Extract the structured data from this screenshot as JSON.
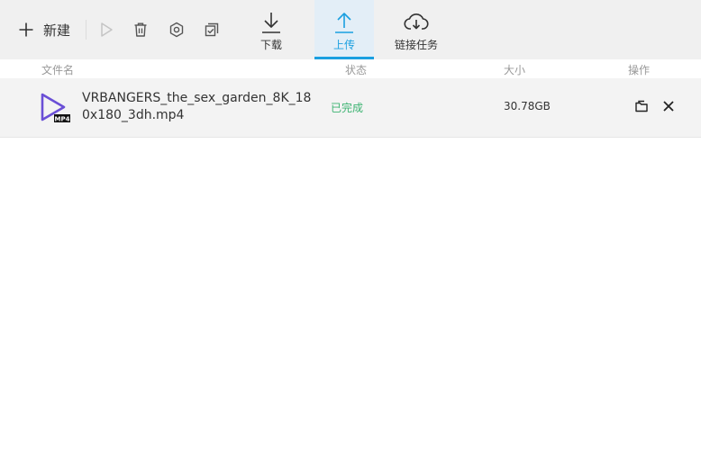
{
  "toolbar": {
    "new_label": "新建",
    "icons": [
      "plus-icon",
      "play-icon",
      "trash-icon",
      "gear-icon",
      "multi-select-icon"
    ],
    "tabs": [
      {
        "label": "下载",
        "icon": "download-icon",
        "active": false
      },
      {
        "label": "上传",
        "icon": "upload-icon",
        "active": true
      },
      {
        "label": "链接任务",
        "icon": "cloud-download-icon",
        "active": false
      }
    ]
  },
  "columns": {
    "name": "文件名",
    "status": "状态",
    "size": "大小",
    "actions": "操作"
  },
  "files": [
    {
      "name": "VRBANGERS_the_sex_garden_8K_180x180_3dh.mp4",
      "type_badge": "MP4",
      "status": "已完成",
      "size": "30.78GB",
      "actions": [
        "open-folder-icon",
        "close-icon"
      ]
    }
  ],
  "colors": {
    "accent": "#1a9fe0",
    "status_done": "#3cb371",
    "file_icon": "#6a4fd6",
    "toolbar_bg": "#f0f0f0"
  }
}
